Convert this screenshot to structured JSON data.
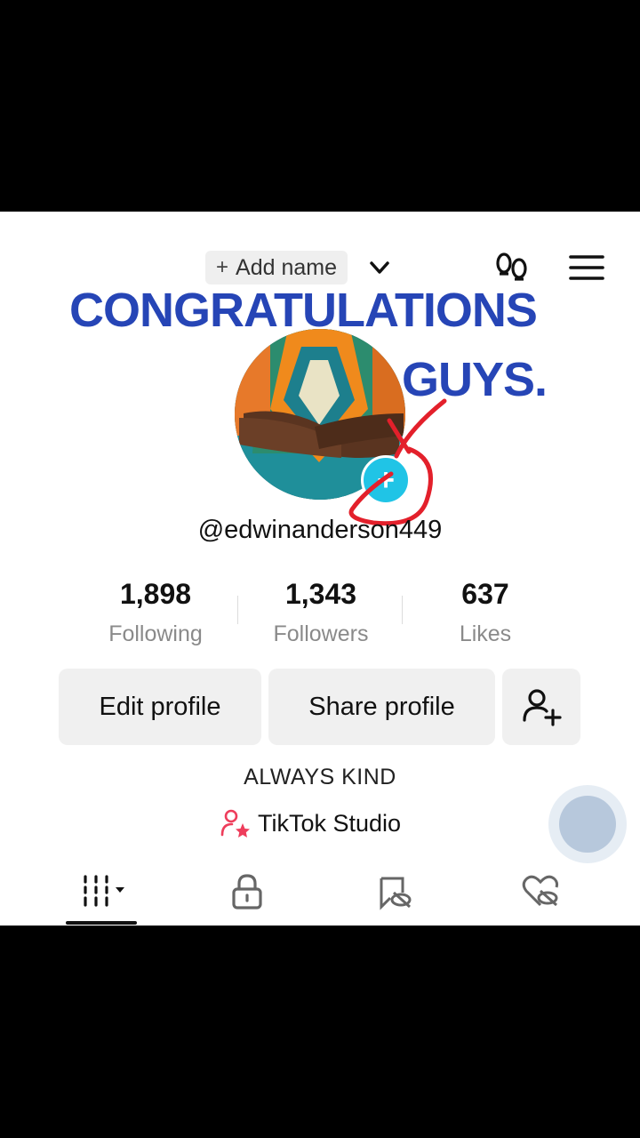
{
  "header": {
    "add_name_plus": "+",
    "add_name_label": "Add name"
  },
  "overlay": {
    "line1": "CONGRATULATIONS",
    "line2": "GUYS."
  },
  "profile": {
    "add_photo": "+",
    "handle": "@edwinanderson449",
    "bio": "ALWAYS KIND",
    "studio_label": "TikTok Studio"
  },
  "stats": [
    {
      "value": "1,898",
      "label": "Following"
    },
    {
      "value": "1,343",
      "label": "Followers"
    },
    {
      "value": "637",
      "label": "Likes"
    }
  ],
  "actions": {
    "edit": "Edit profile",
    "share": "Share profile"
  },
  "colors": {
    "caption": "#2645b6",
    "scribble": "#e3202b",
    "add_photo_badge": "#20c4e6",
    "studio_icon": "#ee3d5b"
  }
}
